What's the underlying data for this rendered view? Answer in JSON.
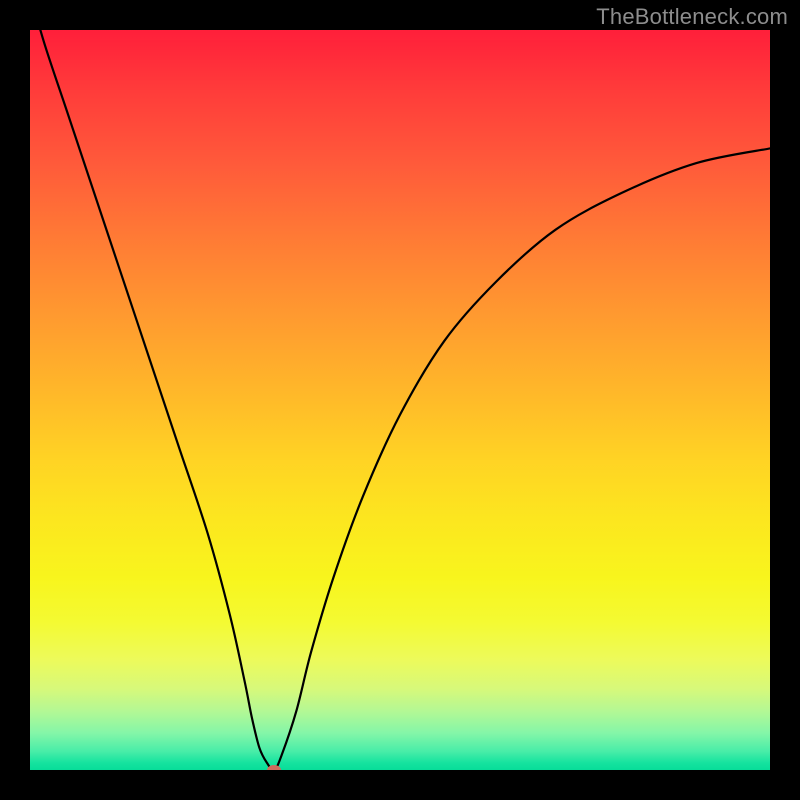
{
  "watermark": "TheBottleneck.com",
  "colors": {
    "frame": "#000000",
    "curve": "#000000",
    "dot": "#cf6b5d"
  },
  "chart_data": {
    "type": "line",
    "title": "",
    "xlabel": "",
    "ylabel": "",
    "xlim": [
      0,
      100
    ],
    "ylim": [
      0,
      100
    ],
    "grid": false,
    "legend": false,
    "series": [
      {
        "name": "bottleneck-curve",
        "x": [
          0,
          2,
          5,
          8,
          12,
          16,
          20,
          24,
          27,
          29,
          30,
          31,
          32,
          33,
          34,
          36,
          38,
          41,
          45,
          50,
          56,
          63,
          71,
          80,
          90,
          100
        ],
        "values": [
          105,
          98,
          89,
          80,
          68,
          56,
          44,
          32,
          21,
          12,
          7,
          3,
          1,
          0,
          2,
          8,
          16,
          26,
          37,
          48,
          58,
          66,
          73,
          78,
          82,
          84
        ]
      }
    ],
    "annotations": [
      {
        "type": "point",
        "name": "valley-marker",
        "x": 33,
        "y": 0
      }
    ]
  }
}
